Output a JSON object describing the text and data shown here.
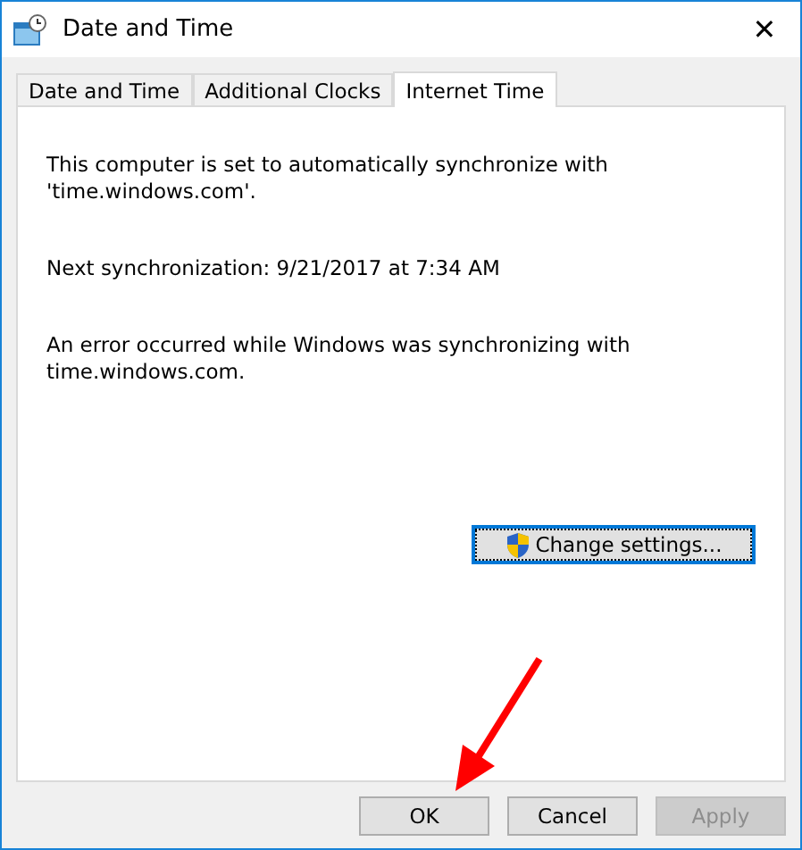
{
  "window": {
    "title": "Date and Time",
    "close": "✕"
  },
  "tabs": [
    {
      "label": "Date and Time",
      "selected": false
    },
    {
      "label": "Additional Clocks",
      "selected": false
    },
    {
      "label": "Internet Time",
      "selected": true
    }
  ],
  "paragraphs": [
    "This computer is set to automatically synchronize with 'time.windows.com'.",
    "Next synchronization: 9/21/2017 at 7:34 AM",
    "An error occurred while Windows was synchronizing with time.windows.com."
  ],
  "change_button": {
    "label": "Change settings...",
    "focused": true
  },
  "buttons": [
    {
      "label": "OK",
      "disabled": false
    },
    {
      "label": "Cancel",
      "disabled": false
    },
    {
      "label": "Apply",
      "disabled": true
    }
  ]
}
